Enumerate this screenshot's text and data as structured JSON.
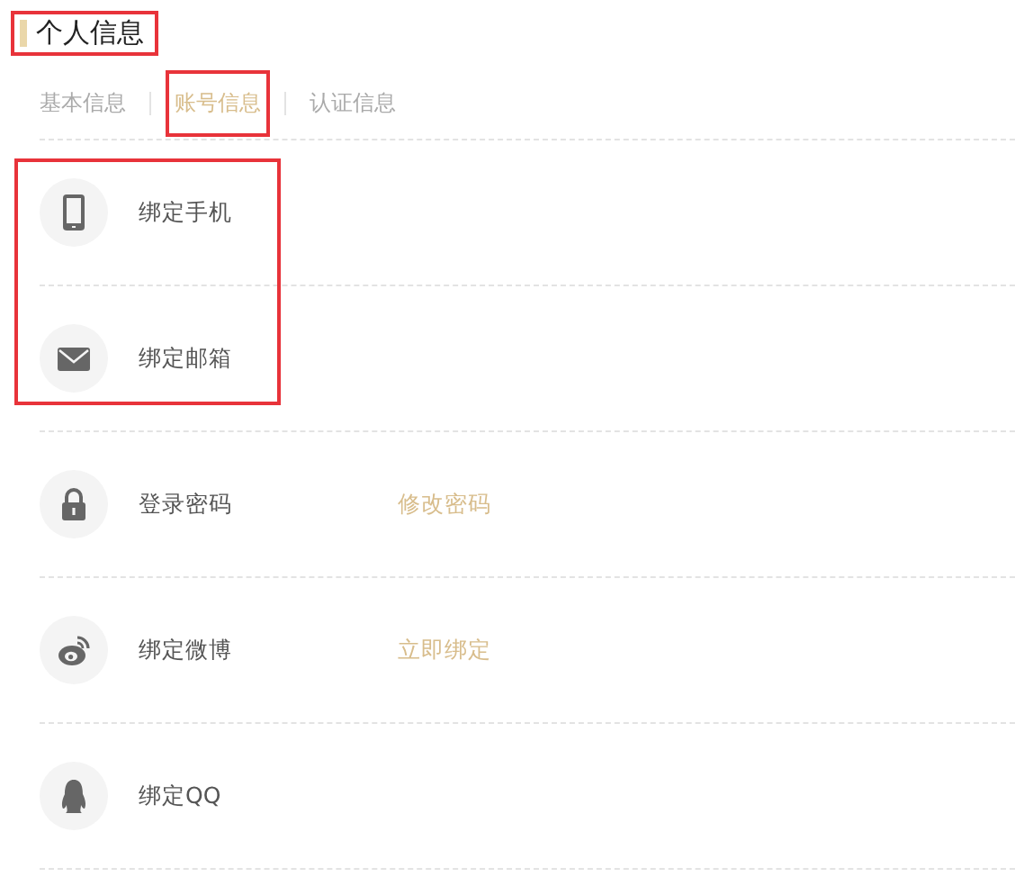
{
  "title": {
    "text": "个人信息",
    "highlighted": true
  },
  "tabs": [
    {
      "label": "基本信息",
      "selected": false,
      "highlighted": false
    },
    {
      "label": "账号信息",
      "selected": true,
      "highlighted": true
    },
    {
      "label": "认证信息",
      "selected": false,
      "highlighted": false
    }
  ],
  "row_groups": [
    {
      "highlighted": true,
      "rows": [
        {
          "kind": "phone",
          "label": "绑定手机"
        },
        {
          "kind": "mail",
          "label": "绑定邮箱"
        }
      ]
    },
    {
      "rows": [
        {
          "kind": "lock",
          "label": "登录密码",
          "action": "修改密码"
        },
        {
          "kind": "weibo",
          "label": "绑定微博",
          "action": "立即绑定"
        },
        {
          "kind": "qq",
          "label": "绑定QQ"
        }
      ]
    }
  ]
}
